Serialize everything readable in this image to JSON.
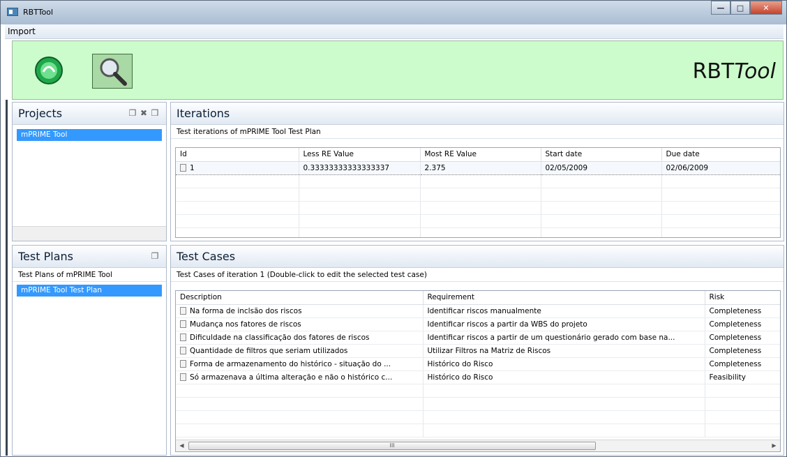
{
  "window": {
    "title": "RBTTool"
  },
  "menu": {
    "import": "Import"
  },
  "banner": {
    "brand_prefix": "RBT",
    "brand_suffix": "Tool"
  },
  "projects": {
    "title": "Projects",
    "items": [
      "mPRIME Tool"
    ]
  },
  "test_plans": {
    "title": "Test Plans",
    "subtitle": "Test Plans of mPRIME Tool",
    "items": [
      "mPRIME Tool Test Plan"
    ]
  },
  "iterations": {
    "title": "Iterations",
    "subtitle": "Test iterations of mPRIME Tool Test Plan",
    "columns": [
      "Id",
      "Less RE Value",
      "Most RE Value",
      "Start date",
      "Due date"
    ],
    "rows": [
      [
        "1",
        "0.33333333333333337",
        "2.375",
        "02/05/2009",
        "02/06/2009"
      ]
    ]
  },
  "test_cases": {
    "title": "Test Cases",
    "subtitle": "Test Cases of iteration 1 (Double-click to edit the selected test case)",
    "columns": [
      "Description",
      "Requirement",
      "Risk"
    ],
    "rows": [
      [
        "Na forma de inclsão dos riscos",
        "Identificar riscos manualmente",
        "Completeness"
      ],
      [
        "Mudança nos fatores de riscos",
        "Identificar riscos a partir da WBS do projeto",
        "Completeness"
      ],
      [
        "Dificuldade na classificação dos fatores de riscos",
        "Identificar riscos a partir de um questionário gerado com base na...",
        "Completeness"
      ],
      [
        "Quantidade de filtros que seriam utilizados",
        "Utilizar Filtros na Matriz de Riscos",
        "Completeness"
      ],
      [
        "Forma de armazenamento do histórico - situação do ...",
        "Histórico do Risco",
        "Completeness"
      ],
      [
        "Só armazenava a última alteração e não o histórico c...",
        "Histórico do Risco",
        "Feasibility"
      ]
    ],
    "scroll_thumb": "III"
  }
}
